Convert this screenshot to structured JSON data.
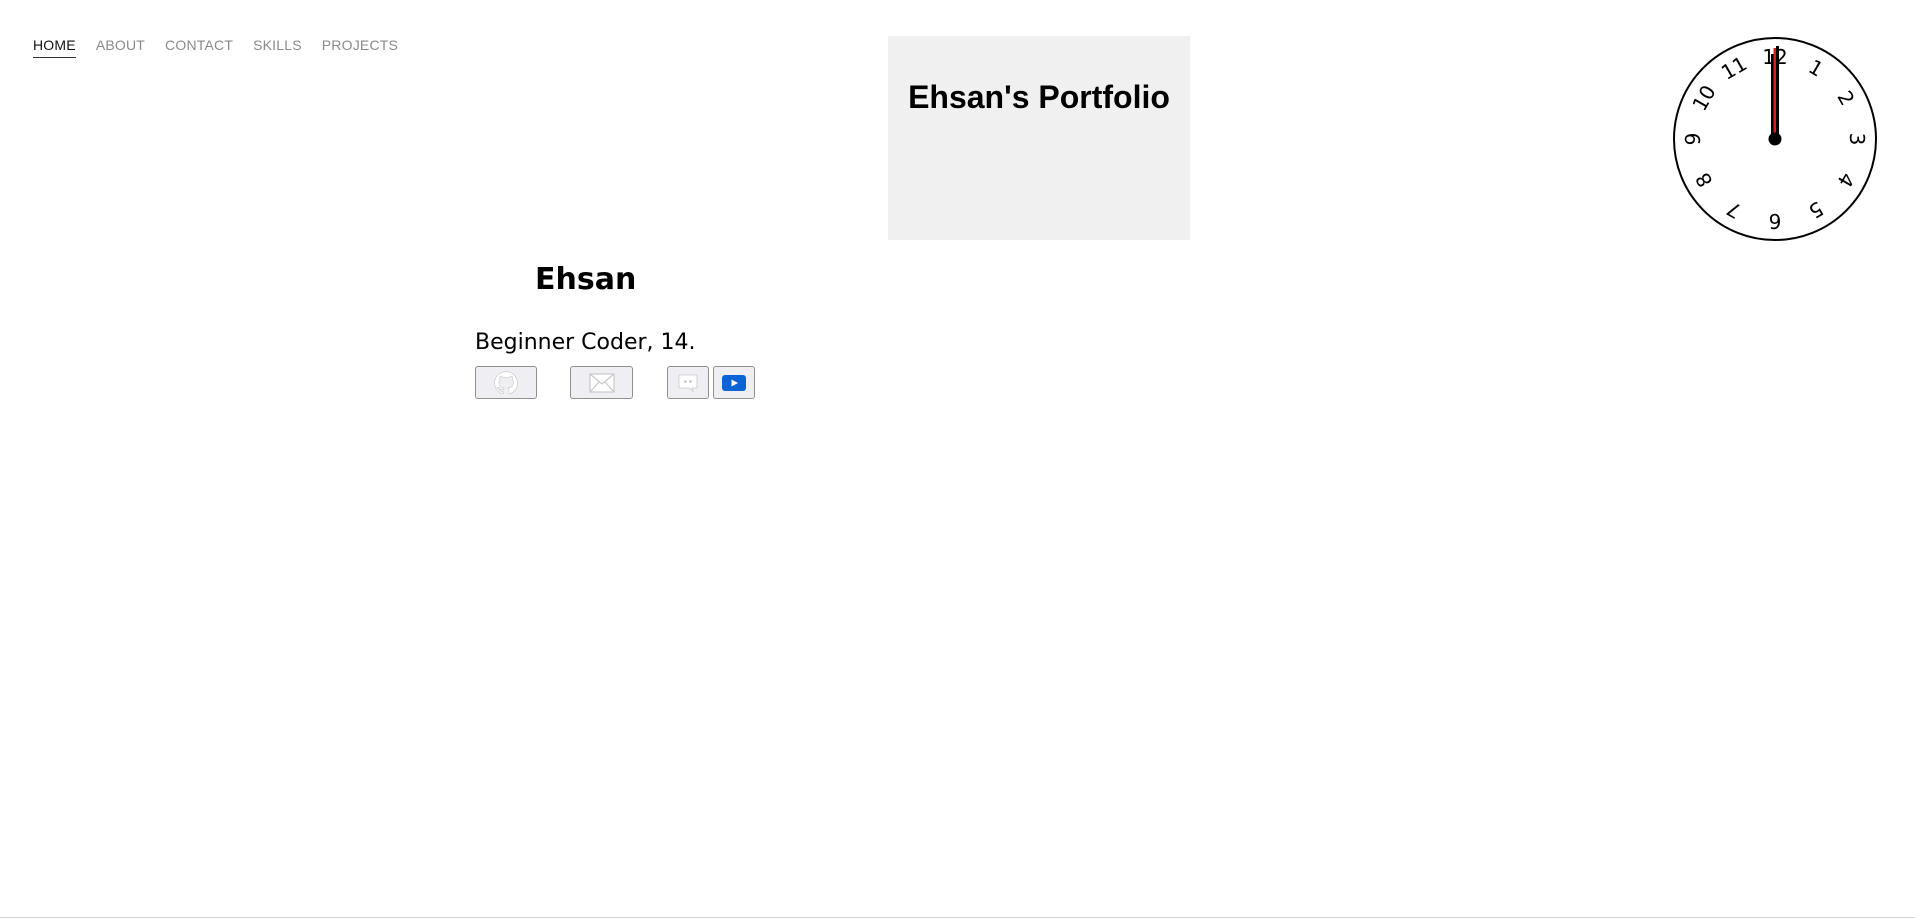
{
  "nav": {
    "items": [
      {
        "label": "HOME",
        "active": true
      },
      {
        "label": "ABOUT",
        "active": false
      },
      {
        "label": "CONTACT",
        "active": false
      },
      {
        "label": "SKILLS",
        "active": false
      },
      {
        "label": "PROJECTS",
        "active": false
      }
    ]
  },
  "header": {
    "title": "Ehsan's Portfolio",
    "background": "#f0f0f0"
  },
  "clock": {
    "numerals": [
      "12",
      "1",
      "2",
      "3",
      "4",
      "5",
      "6",
      "7",
      "8",
      "9",
      "10",
      "11"
    ],
    "hand_color": "#d62020",
    "time_shown": "12:00"
  },
  "profile": {
    "name": "Ehsan",
    "tagline": "Beginner Coder, 14."
  },
  "social": [
    {
      "name": "github",
      "icon": "github-icon"
    },
    {
      "name": "email",
      "icon": "envelope-icon"
    },
    {
      "name": "discord",
      "icon": "discord-icon"
    },
    {
      "name": "youtube",
      "icon": "youtube-icon",
      "color": "#0a64d6"
    }
  ]
}
